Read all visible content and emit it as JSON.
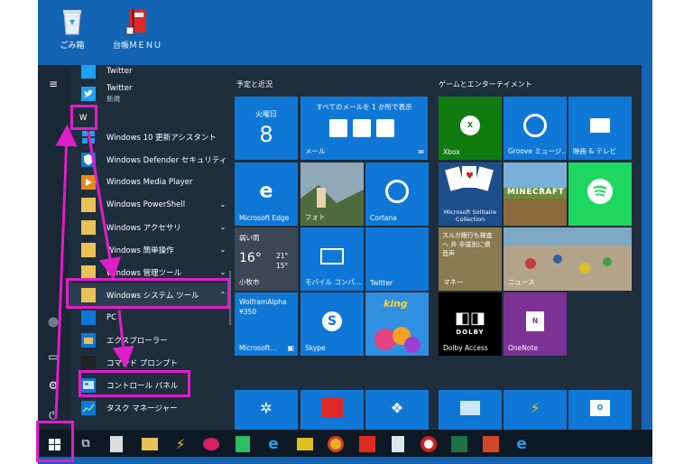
{
  "desktop": {
    "icons": [
      {
        "label": "ごみ箱",
        "icon": "recycle-bin-icon"
      },
      {
        "label": "台帳ＭＥＮＵ",
        "icon": "ledger-app-icon"
      }
    ]
  },
  "start_menu": {
    "app_list": [
      {
        "label": "Twitter",
        "icon": "twitter-icon",
        "sub": ""
      },
      {
        "label": "Twitter",
        "icon": "twitter-icon",
        "sub": "新規"
      },
      {
        "letter": "W"
      },
      {
        "label": "Windows 10 更新アシスタント",
        "icon": "windows-icon"
      },
      {
        "label": "Windows Defender セキュリティ セン…",
        "icon": "shield-icon"
      },
      {
        "label": "Windows Media Player",
        "icon": "media-player-icon"
      },
      {
        "label": "Windows PowerShell",
        "icon": "folder-icon"
      },
      {
        "label": "Windows アクセサリ",
        "icon": "folder-icon"
      },
      {
        "label": "Windows 簡単操作",
        "icon": "folder-icon"
      },
      {
        "label": "Windows 管理ツール",
        "icon": "folder-icon"
      },
      {
        "label": "Windows システム ツール",
        "icon": "folder-icon"
      },
      {
        "label": "PC",
        "icon": "pc-icon"
      },
      {
        "label": "エクスプローラー",
        "icon": "explorer-icon"
      },
      {
        "label": "コマンド プロンプト",
        "icon": "cmd-icon"
      },
      {
        "label": "コントロール パネル",
        "icon": "control-panel-icon"
      },
      {
        "label": "タスク マネージャー",
        "icon": "task-manager-icon"
      }
    ],
    "chevrons": [
      "⌄",
      "⌃"
    ],
    "sections": {
      "left": "予定と近況",
      "right": "ゲームとエンターテイメント"
    },
    "tiles": {
      "calendar_day": "火曜日",
      "calendar_date": "8",
      "mail_header": "すべてのメールを 1 か所で表示",
      "mail_label": "メール",
      "edge_label": "Microsoft Edge",
      "photos_label": "フォト",
      "cortana_label": "Cortana",
      "weather_cond": "弱い雨",
      "weather_temp": "16°",
      "weather_hi": "21°",
      "weather_lo": "15°",
      "weather_city": "小牧市",
      "mobile_label": "モバイル コンパ…",
      "twitter_label": "Twitter",
      "wolfram_label": "WolframAlpha",
      "wolfram_price": "¥350",
      "office_label": "Microsoft…",
      "skype_label": "Skype",
      "xbox_label": "Xbox",
      "groove_label": "Groove ミュージ…",
      "movies_label": "映画 & テレビ",
      "solitaire_label": "Microsoft Solitaire Collection",
      "minecraft_label": "MINECRAFT",
      "money_headline": "スルガ銀行も検査へ 弁 非識別に債 音声",
      "money_label": "マネー",
      "news_label": "ニュース",
      "dolby_brand": "DOLBY",
      "dolby_label": "Dolby Access",
      "onenote_label": "OneNote",
      "king_label": "king"
    }
  },
  "colors": {
    "highlight": "#e01ec8",
    "desktop": "#1464b4",
    "tile_blue": "#0f78d7",
    "xbox_green": "#107c10"
  }
}
